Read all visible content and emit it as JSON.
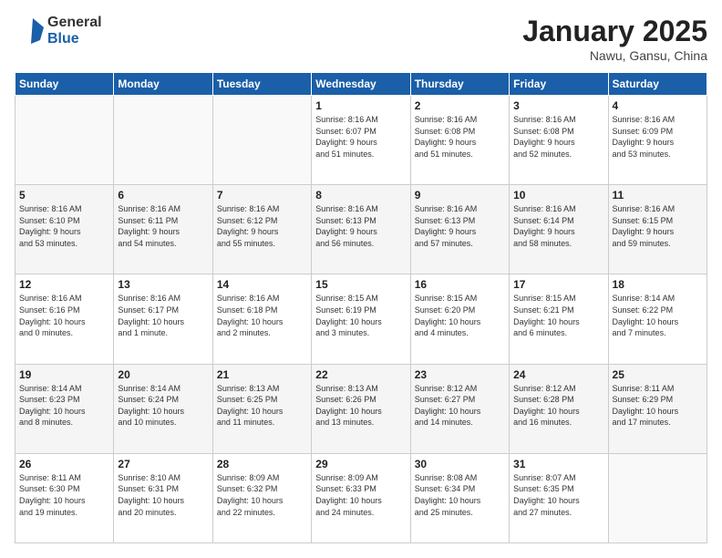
{
  "header": {
    "logo_general": "General",
    "logo_blue": "Blue",
    "month": "January 2025",
    "location": "Nawu, Gansu, China"
  },
  "weekdays": [
    "Sunday",
    "Monday",
    "Tuesday",
    "Wednesday",
    "Thursday",
    "Friday",
    "Saturday"
  ],
  "weeks": [
    [
      {
        "day": "",
        "info": ""
      },
      {
        "day": "",
        "info": ""
      },
      {
        "day": "",
        "info": ""
      },
      {
        "day": "1",
        "info": "Sunrise: 8:16 AM\nSunset: 6:07 PM\nDaylight: 9 hours\nand 51 minutes."
      },
      {
        "day": "2",
        "info": "Sunrise: 8:16 AM\nSunset: 6:08 PM\nDaylight: 9 hours\nand 51 minutes."
      },
      {
        "day": "3",
        "info": "Sunrise: 8:16 AM\nSunset: 6:08 PM\nDaylight: 9 hours\nand 52 minutes."
      },
      {
        "day": "4",
        "info": "Sunrise: 8:16 AM\nSunset: 6:09 PM\nDaylight: 9 hours\nand 53 minutes."
      }
    ],
    [
      {
        "day": "5",
        "info": "Sunrise: 8:16 AM\nSunset: 6:10 PM\nDaylight: 9 hours\nand 53 minutes."
      },
      {
        "day": "6",
        "info": "Sunrise: 8:16 AM\nSunset: 6:11 PM\nDaylight: 9 hours\nand 54 minutes."
      },
      {
        "day": "7",
        "info": "Sunrise: 8:16 AM\nSunset: 6:12 PM\nDaylight: 9 hours\nand 55 minutes."
      },
      {
        "day": "8",
        "info": "Sunrise: 8:16 AM\nSunset: 6:13 PM\nDaylight: 9 hours\nand 56 minutes."
      },
      {
        "day": "9",
        "info": "Sunrise: 8:16 AM\nSunset: 6:13 PM\nDaylight: 9 hours\nand 57 minutes."
      },
      {
        "day": "10",
        "info": "Sunrise: 8:16 AM\nSunset: 6:14 PM\nDaylight: 9 hours\nand 58 minutes."
      },
      {
        "day": "11",
        "info": "Sunrise: 8:16 AM\nSunset: 6:15 PM\nDaylight: 9 hours\nand 59 minutes."
      }
    ],
    [
      {
        "day": "12",
        "info": "Sunrise: 8:16 AM\nSunset: 6:16 PM\nDaylight: 10 hours\nand 0 minutes."
      },
      {
        "day": "13",
        "info": "Sunrise: 8:16 AM\nSunset: 6:17 PM\nDaylight: 10 hours\nand 1 minute."
      },
      {
        "day": "14",
        "info": "Sunrise: 8:16 AM\nSunset: 6:18 PM\nDaylight: 10 hours\nand 2 minutes."
      },
      {
        "day": "15",
        "info": "Sunrise: 8:15 AM\nSunset: 6:19 PM\nDaylight: 10 hours\nand 3 minutes."
      },
      {
        "day": "16",
        "info": "Sunrise: 8:15 AM\nSunset: 6:20 PM\nDaylight: 10 hours\nand 4 minutes."
      },
      {
        "day": "17",
        "info": "Sunrise: 8:15 AM\nSunset: 6:21 PM\nDaylight: 10 hours\nand 6 minutes."
      },
      {
        "day": "18",
        "info": "Sunrise: 8:14 AM\nSunset: 6:22 PM\nDaylight: 10 hours\nand 7 minutes."
      }
    ],
    [
      {
        "day": "19",
        "info": "Sunrise: 8:14 AM\nSunset: 6:23 PM\nDaylight: 10 hours\nand 8 minutes."
      },
      {
        "day": "20",
        "info": "Sunrise: 8:14 AM\nSunset: 6:24 PM\nDaylight: 10 hours\nand 10 minutes."
      },
      {
        "day": "21",
        "info": "Sunrise: 8:13 AM\nSunset: 6:25 PM\nDaylight: 10 hours\nand 11 minutes."
      },
      {
        "day": "22",
        "info": "Sunrise: 8:13 AM\nSunset: 6:26 PM\nDaylight: 10 hours\nand 13 minutes."
      },
      {
        "day": "23",
        "info": "Sunrise: 8:12 AM\nSunset: 6:27 PM\nDaylight: 10 hours\nand 14 minutes."
      },
      {
        "day": "24",
        "info": "Sunrise: 8:12 AM\nSunset: 6:28 PM\nDaylight: 10 hours\nand 16 minutes."
      },
      {
        "day": "25",
        "info": "Sunrise: 8:11 AM\nSunset: 6:29 PM\nDaylight: 10 hours\nand 17 minutes."
      }
    ],
    [
      {
        "day": "26",
        "info": "Sunrise: 8:11 AM\nSunset: 6:30 PM\nDaylight: 10 hours\nand 19 minutes."
      },
      {
        "day": "27",
        "info": "Sunrise: 8:10 AM\nSunset: 6:31 PM\nDaylight: 10 hours\nand 20 minutes."
      },
      {
        "day": "28",
        "info": "Sunrise: 8:09 AM\nSunset: 6:32 PM\nDaylight: 10 hours\nand 22 minutes."
      },
      {
        "day": "29",
        "info": "Sunrise: 8:09 AM\nSunset: 6:33 PM\nDaylight: 10 hours\nand 24 minutes."
      },
      {
        "day": "30",
        "info": "Sunrise: 8:08 AM\nSunset: 6:34 PM\nDaylight: 10 hours\nand 25 minutes."
      },
      {
        "day": "31",
        "info": "Sunrise: 8:07 AM\nSunset: 6:35 PM\nDaylight: 10 hours\nand 27 minutes."
      },
      {
        "day": "",
        "info": ""
      }
    ]
  ]
}
